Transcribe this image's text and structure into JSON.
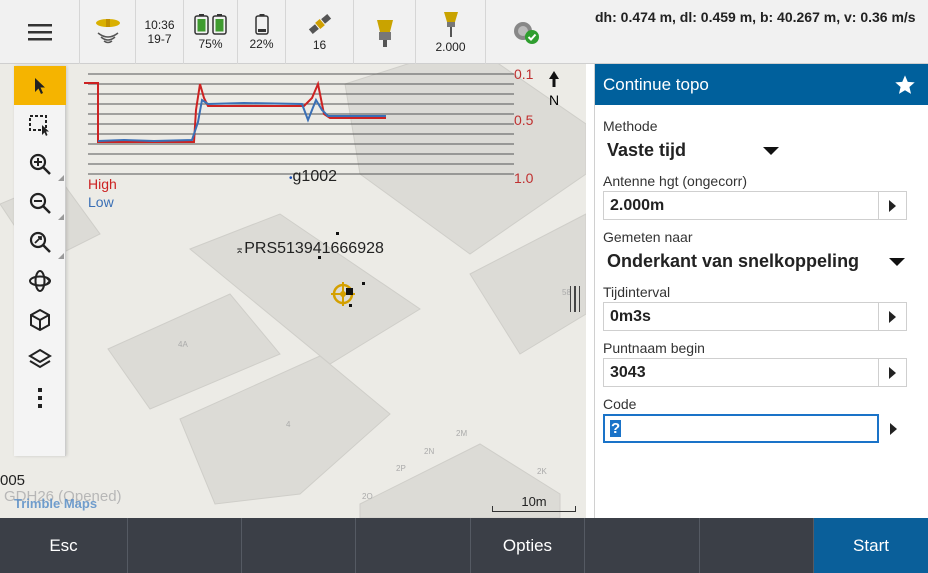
{
  "topbar": {
    "menu_icon": "hamburger-menu-icon",
    "gnss_icon": "gnss-receiver-icon",
    "time": "10:36",
    "date": "19-7",
    "battery1_pct": "75%",
    "battery2_pct": "22%",
    "satellites": "16",
    "antenna_height": "2.000",
    "colors": {
      "battery_fill": "#3f9b2f",
      "satellite": "#d0a000",
      "ok_badge": "#2f9e2f"
    }
  },
  "readout": {
    "text": "dh: 0.474 m, dl: 0.459 m, b: 40.267 m, v: 0.36 m/s"
  },
  "map": {
    "chart_labels": {
      "right_top": "0.1",
      "right_mid": "0.5",
      "right_bottom": "1.0",
      "high": "High",
      "low": "Low"
    },
    "north_label": "N",
    "point_g1002": "g1002",
    "point_prs": "PRS513941666928",
    "scale_label": "10m",
    "left_number": "005",
    "watermark": "Trimble Maps",
    "watermark_behind": "GDH26 (Opened)",
    "building_labels": [
      "4A",
      "4",
      "2M",
      "2N",
      "2P",
      "2K",
      "2O",
      "58"
    ],
    "colors": {
      "chart_high": "#cc2222",
      "chart_low": "#3a6fb5",
      "chart_axis_label": "#c03030",
      "selection": "#f5b400"
    }
  },
  "toolbar": {
    "tools": [
      {
        "name": "select-arrow-icon"
      },
      {
        "name": "box-select-icon"
      },
      {
        "name": "zoom-in-icon"
      },
      {
        "name": "zoom-out-icon"
      },
      {
        "name": "zoom-extents-icon"
      },
      {
        "name": "orbit-icon"
      },
      {
        "name": "cube-view-icon"
      },
      {
        "name": "layers-icon"
      },
      {
        "name": "more-options-icon"
      }
    ]
  },
  "panel": {
    "title": "Continue topo",
    "star_icon": "favorite-star-icon",
    "methode_label": "Methode",
    "methode_value": "Vaste tijd",
    "antenne_label": "Antenne hgt (ongecorr)",
    "antenne_value": "2.000m",
    "gemeten_label": "Gemeten naar",
    "gemeten_value": "Onderkant van snelkoppeling",
    "tijd_label": "Tijdinterval",
    "tijd_value": "0m3s",
    "puntnaam_label": "Puntnaam begin",
    "puntnaam_value": "3043",
    "code_label": "Code",
    "code_value": "?",
    "colors": {
      "header": "#00609c",
      "focus": "#1a73c8"
    }
  },
  "softkeys": [
    "Esc",
    "",
    "",
    "",
    "Opties",
    "",
    "",
    "Start"
  ]
}
